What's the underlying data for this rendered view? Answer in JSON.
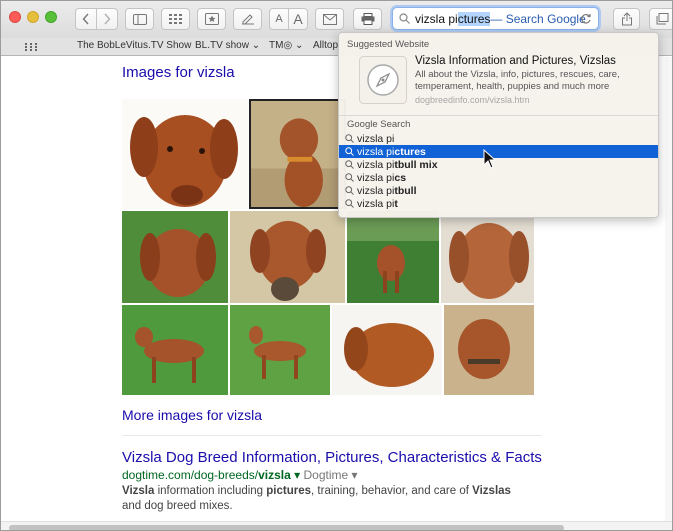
{
  "colors": {
    "accent": "#1162d6",
    "link": "#1a0dab",
    "green_url": "#006621"
  },
  "toolbar": {
    "traffic_lights": [
      "#fc5b57",
      "#e5bf3c",
      "#57c038"
    ],
    "back_icon": "chevron-left-icon",
    "forward_icon": "chevron-right-icon",
    "font_small": "A",
    "font_large": "A",
    "address": {
      "typed": "vizsla pi",
      "selected": "ctures",
      "hint": " — Search Google"
    }
  },
  "bookmarks": {
    "items": [
      "The BobLeVitus.TV Show",
      "BL.TV show ⌄",
      "TM◎ ⌄",
      "Alltop"
    ]
  },
  "dropdown": {
    "suggested_heading": "Suggested Website",
    "site_title": "Vizsla Information and Pictures, Vizslas",
    "site_desc": "All about the Vizsla, info, pictures, rescues, care, temperament, health, puppies and much more",
    "site_url": "dogbreedinfo.com/vizsla.htm",
    "google_heading": "Google Search",
    "suggestions": [
      {
        "pre": "vizsla pi",
        "rest": ""
      },
      {
        "pre": "vizsla pi",
        "rest": "ctures"
      },
      {
        "pre": "vizsla pi",
        "rest": "tbull mix"
      },
      {
        "pre": "vizsla pi",
        "rest": "cs"
      },
      {
        "pre": "vizsla pi",
        "rest": "tbull"
      },
      {
        "pre": "vizsla pi",
        "rest": "t"
      }
    ],
    "selected_index": 1
  },
  "content": {
    "images_heading": "Images for vizsla",
    "more_images": "More images for vizsla",
    "result": {
      "title": "Vizsla Dog Breed Information, Pictures, Characteristics & Facts",
      "url_prefix": "dogtime.com/dog-breeds/",
      "url_bold": "vizsla",
      "url_suffix": " ▾",
      "source": " Dogtime ▾",
      "snippet_parts": [
        "Vizsla",
        " information including ",
        "pictures",
        ", training, behavior, and care of ",
        "Vizslas",
        " and dog breed mixes."
      ]
    }
  }
}
